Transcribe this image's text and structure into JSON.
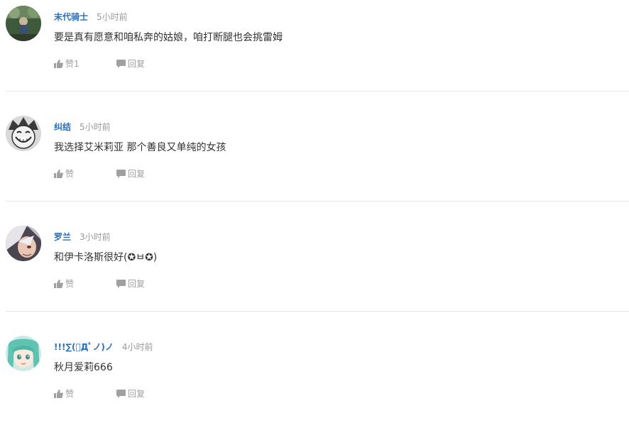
{
  "comments": [
    {
      "username": "末代骑士",
      "time": "5小时前",
      "text": "要是真有愿意和咱私奔的姑娘，咱打断腿也会挑雷姆",
      "like_label": "赞1",
      "reply_label": "回复"
    },
    {
      "username": "纠结",
      "time": "5小时前",
      "text": "我选择艾米莉亚 那个善良又单纯的女孩",
      "like_label": "赞",
      "reply_label": "回复"
    },
    {
      "username": "罗兰",
      "time": "3小时前",
      "text": "和伊卡洛斯很好(✪ㅂ✪)",
      "like_label": "赞",
      "reply_label": "回复"
    },
    {
      "username": "!!!∑(ﾟДﾟノ)ノ",
      "time": "4小时前",
      "text": "秋月爱莉666",
      "like_label": "赞",
      "reply_label": "回复"
    }
  ],
  "icons": {
    "like": "thumbs-up-icon",
    "reply": "speech-bubble-icon"
  },
  "colors": {
    "username": "#2a6ebb",
    "muted": "#999999",
    "text": "#333333",
    "action": "#a0a0a0",
    "divider": "#e8e8e8"
  }
}
